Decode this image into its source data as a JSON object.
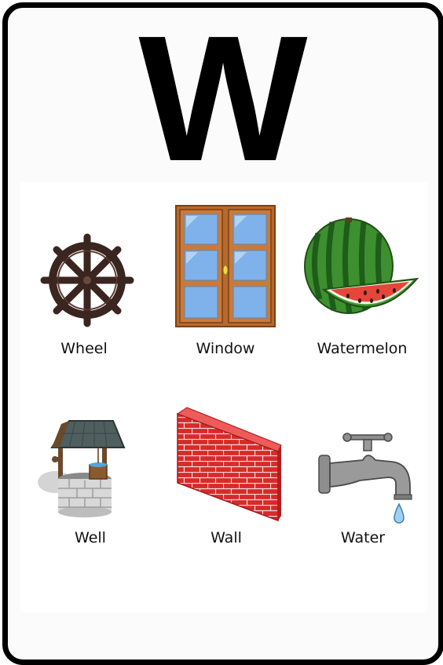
{
  "card": {
    "letter": "W",
    "items": [
      {
        "label": "Wheel",
        "icon": "ship-wheel-icon"
      },
      {
        "label": "Window",
        "icon": "window-icon"
      },
      {
        "label": "Watermelon",
        "icon": "watermelon-icon"
      },
      {
        "label": "Well",
        "icon": "well-icon"
      },
      {
        "label": "Wall",
        "icon": "brick-wall-icon"
      },
      {
        "label": "Water",
        "icon": "water-tap-icon"
      }
    ]
  },
  "colors": {
    "border": "#000000",
    "wheel": "#3b2520",
    "window_frame": "#b7692e",
    "window_glass": "#7fb2ea",
    "melon_green": "#3e8f2f",
    "melon_flesh": "#e6453a",
    "brick": "#d82a2a",
    "tap": "#8e8e8e",
    "water_drop": "#9fd1ef"
  }
}
